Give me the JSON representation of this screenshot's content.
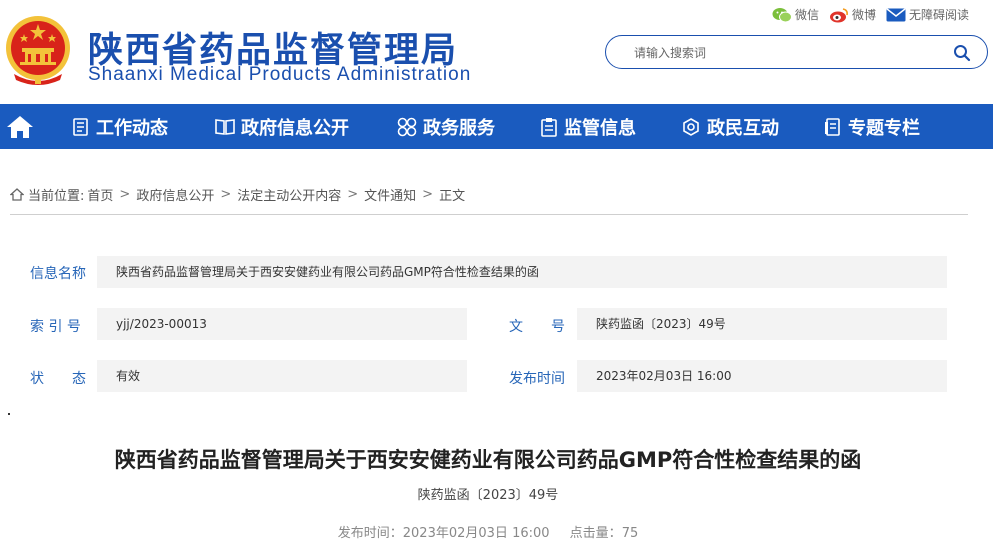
{
  "header": {
    "title_cn": "陕西省药品监督管理局",
    "title_en": "Shaanxi Medical Products Administration",
    "share": {
      "wechat": "微信",
      "weibo": "微博",
      "accessible": "无障碍阅读"
    },
    "search": {
      "placeholder": "请输入搜索词"
    }
  },
  "nav": {
    "items": [
      {
        "label": "工作动态",
        "icon": "news-icon"
      },
      {
        "label": "政府信息公开",
        "icon": "book-icon"
      },
      {
        "label": "政务服务",
        "icon": "services-icon"
      },
      {
        "label": "监管信息",
        "icon": "clipboard-icon"
      },
      {
        "label": "政民互动",
        "icon": "interaction-icon"
      },
      {
        "label": "专题专栏",
        "icon": "topic-icon"
      }
    ]
  },
  "breadcrumb": {
    "prefix": "当前位置:",
    "items": [
      "首页",
      "政府信息公开",
      "法定主动公开内容",
      "文件通知",
      "正文"
    ],
    "separator": ">"
  },
  "info": {
    "name_label": "信息名称",
    "name_value": "陕西省药品监督管理局关于西安安健药业有限公司药品GMP符合性检查结果的函",
    "index_label": "索 引 号",
    "index_value": "yjj/2023-00013",
    "docno_label": "文　　号",
    "docno_value": "陕药监函〔2023〕49号",
    "status_label": "状　　态",
    "status_value": "有效",
    "date_label": "发布时间",
    "date_value": "2023年02月03日 16:00"
  },
  "article": {
    "title": "陕西省药品监督管理局关于西安安健药业有限公司药品GMP符合性检查结果的函",
    "doc_number": "陕药监函〔2023〕49号",
    "publish_label": "发布时间：",
    "publish_value": "2023年02月03日 16:00",
    "clicks_label": "点击量：",
    "clicks_value": "75"
  },
  "colors": {
    "brand_blue": "#1a4fae",
    "nav_blue": "#1a5bbf",
    "label_blue": "#2766b8",
    "emblem_red": "#d8231a",
    "emblem_gold": "#f3c23a"
  }
}
